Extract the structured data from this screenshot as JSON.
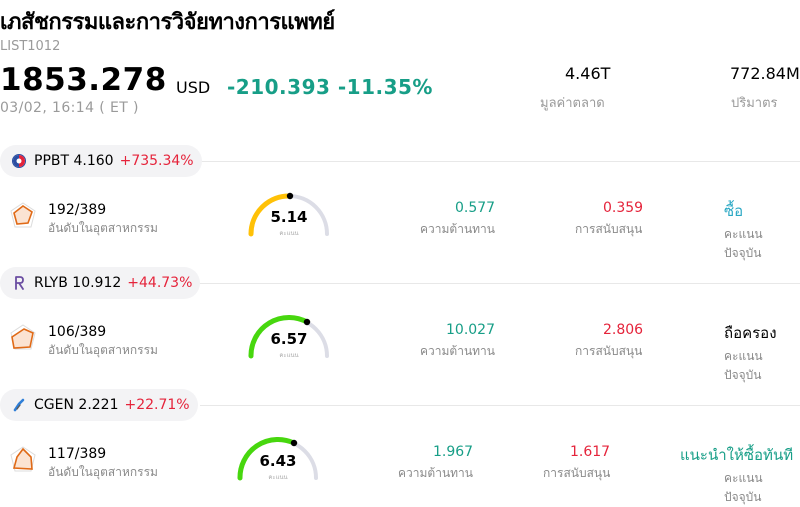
{
  "header": {
    "title": "เภสัชกรรมและการวิจัยทางการแพทย์",
    "code": "LIST1012",
    "price": "1853.278",
    "currency": "USD",
    "change": "-210.393 -11.35%",
    "timestamp": "03/02, 16:14  ( ET )",
    "market_cap_value": "4.46T",
    "market_cap_label": "มูลค่าตลาด",
    "volume_value": "772.84M",
    "volume_label": "ปริมาตร"
  },
  "colors": {
    "green": "#179e87",
    "red": "#e5243b",
    "gauge_yellow": "#ffc107",
    "gauge_green": "#47d70e",
    "gauge_track": "#dcdde6"
  },
  "stocks": [
    {
      "ticker": "PPBT",
      "price": "4.160",
      "change": "+735.34%",
      "logo_icon": "ppbt-logo-icon",
      "rank": "192/389",
      "rank_label": "อันดับในอุตสาหกรรม",
      "score": "5.14",
      "score_label": "คะแนน",
      "score_fraction": 0.45,
      "resistance": "0.577",
      "resistance_label": "ความต้านทาน",
      "support": "0.359",
      "support_label": "การสนับสนุน",
      "recommendation": "ซื้อ",
      "recommendation_label": "คะแนนปัจจุบัน"
    },
    {
      "ticker": "RLYB",
      "price": "10.912",
      "change": "+44.73%",
      "logo_icon": "rlyb-logo-icon",
      "rank": "106/389",
      "rank_label": "อันดับในอุตสาหกรรม",
      "score": "6.57",
      "score_label": "คะแนน",
      "score_fraction": 0.7,
      "resistance": "10.027",
      "resistance_label": "ความต้านทาน",
      "support": "2.806",
      "support_label": "การสนับสนุน",
      "recommendation": "ถือครอง",
      "recommendation_label": "คะแนนปัจจุบัน"
    },
    {
      "ticker": "CGEN",
      "price": "2.221",
      "change": "+22.71%",
      "logo_icon": "cgen-logo-icon",
      "rank": "117/389",
      "rank_label": "อันดับในอุตสาหกรรม",
      "score": "6.43",
      "score_label": "คะแนน",
      "score_fraction": 0.68,
      "resistance": "1.967",
      "resistance_label": "ความต้านทาน",
      "support": "1.617",
      "support_label": "การสนับสนุน",
      "recommendation": "แนะนำให้ซื้อทันที",
      "recommendation_label": "คะแนนปัจจุบัน"
    }
  ]
}
